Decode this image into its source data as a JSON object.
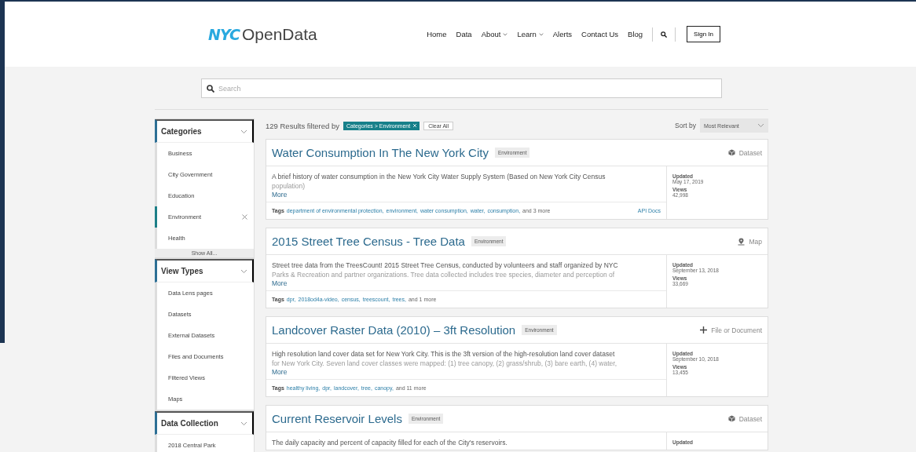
{
  "header": {
    "logo_mark": "NYC",
    "logo_text": "OpenData",
    "nav": [
      {
        "label": "Home",
        "dropdown": false
      },
      {
        "label": "Data",
        "dropdown": false
      },
      {
        "label": "About",
        "dropdown": true
      },
      {
        "label": "Learn",
        "dropdown": true
      },
      {
        "label": "Alerts",
        "dropdown": false
      },
      {
        "label": "Contact Us",
        "dropdown": false
      },
      {
        "label": "Blog",
        "dropdown": false
      }
    ],
    "sign_in": "Sign In"
  },
  "search": {
    "placeholder": "Search"
  },
  "sidebar": {
    "sections": [
      {
        "title": "Categories",
        "expanded": true,
        "items": [
          {
            "label": "Business",
            "selected": false
          },
          {
            "label": "City Government",
            "selected": false
          },
          {
            "label": "Education",
            "selected": false
          },
          {
            "label": "Environment",
            "selected": true
          },
          {
            "label": "Health",
            "selected": false
          }
        ],
        "show_all": "Show All..."
      },
      {
        "title": "View Types",
        "expanded": true,
        "items": [
          {
            "label": "Data Lens pages",
            "selected": false
          },
          {
            "label": "Datasets",
            "selected": false
          },
          {
            "label": "External Datasets",
            "selected": false
          },
          {
            "label": "Files and Documents",
            "selected": false
          },
          {
            "label": "Filtered Views",
            "selected": false
          },
          {
            "label": "Maps",
            "selected": false
          }
        ]
      },
      {
        "title": "Data Collection",
        "expanded": true,
        "items": [
          {
            "label": "2018 Central Park",
            "selected": false
          }
        ]
      }
    ]
  },
  "results": {
    "summary": "129 Results filtered by",
    "filter_chip": "Categories > Environment",
    "clear_all": "Clear All",
    "sort_label": "Sort by",
    "sort_value": "Most Relevant",
    "cards": [
      {
        "title": "Water Consumption In The New York City",
        "category": "Environment",
        "kind": "dataset",
        "type_label": "Dataset",
        "description_lines": [
          "A brief history of water consumption in the New York City Water Supply System (Based on New York City Census",
          "population)"
        ],
        "more": "More",
        "tags_label": "Tags",
        "tags": [
          "department of environmental protection,",
          "environment,",
          "water consumption,",
          "water,",
          "consumption,"
        ],
        "tags_more": "and 3 more",
        "api_docs": "API Docs",
        "updated_label": "Updated",
        "updated": "May 17, 2019",
        "views_label": "Views",
        "views": "42,998"
      },
      {
        "title": "2015 Street Tree Census - Tree Data",
        "category": "Environment",
        "kind": "map",
        "type_label": "Map",
        "description_lines": [
          "Street tree data from the TreesCount! 2015 Street Tree Census, conducted by volunteers and staff organized by NYC",
          "Parks & Recreation and partner organizations. Tree data collected includes tree species, diameter and perception of"
        ],
        "more": "More",
        "tags_label": "Tags",
        "tags": [
          "dpr,",
          "2018od4a-video,",
          "census,",
          "treescount,",
          "trees,"
        ],
        "tags_more": "and 1 more",
        "updated_label": "Updated",
        "updated": "September 13, 2018",
        "views_label": "Views",
        "views": "33,669"
      },
      {
        "title": "Landcover Raster Data (2010) – 3ft Resolution",
        "category": "Environment",
        "kind": "file",
        "type_label": "File or Document",
        "description_lines": [
          "High resolution land cover data set for New York City. This is the 3ft version of the high-resolution land cover dataset",
          "for New York City. Seven land cover classes were mapped: (1) tree canopy, (2) grass/shrub, (3) bare earth, (4) water,"
        ],
        "more": "More",
        "tags_label": "Tags",
        "tags": [
          "healthy living,",
          "dpr,",
          "landcover,",
          "tree,",
          "canopy,"
        ],
        "tags_more": "and 11 more",
        "updated_label": "Updated",
        "updated": "September 10, 2018",
        "views_label": "Views",
        "views": "13,455"
      },
      {
        "title": "Current Reservoir Levels",
        "category": "Environment",
        "kind": "dataset",
        "type_label": "Dataset",
        "description_lines": [
          "The daily capacity and percent of capacity filled for each of the City's reservoirs."
        ],
        "updated_label": "Updated"
      }
    ]
  }
}
